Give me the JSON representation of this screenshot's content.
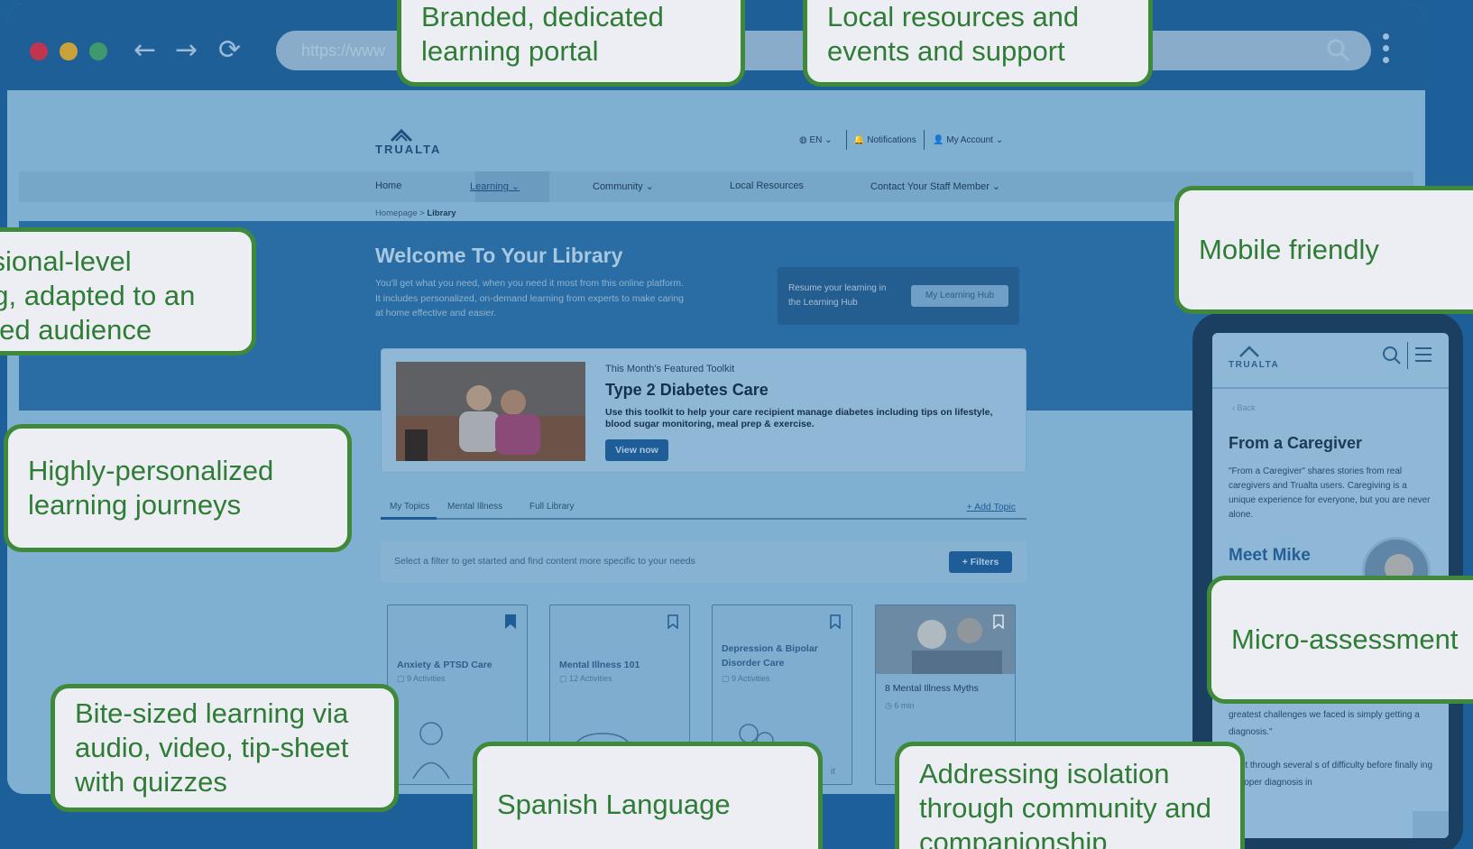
{
  "browser": {
    "url_placeholder": "https://www",
    "back_icon": "back-arrow-icon",
    "forward_icon": "forward-arrow-icon",
    "reload_icon": "reload-icon"
  },
  "site": {
    "logo_text": "TRUALTA",
    "lang": "EN",
    "notifications": "Notifications",
    "account": "My Account",
    "nav": {
      "home": "Home",
      "learning": "Learning",
      "community": "Community",
      "local": "Local Resources",
      "contact": "Contact Your Staff Member"
    },
    "breadcrumb": {
      "home": "Homepage",
      "sep": ">",
      "current": "Library"
    },
    "welcome_title": "Welcome To Your Library",
    "welcome_sub": "You'll get what you need, when you need it most from this online platform. It includes personalized, on-demand learning from experts to make caring at home effective and easier.",
    "resume_text": "Resume your learning in the Learning Hub",
    "resume_btn": "My Learning Hub",
    "featured": {
      "label": "This Month's Featured Toolkit",
      "title": "Type 2 Diabetes Care",
      "desc": "Use this toolkit to help your care recipient manage diabetes including tips on lifestyle, blood sugar monitoring, meal prep & exercise.",
      "btn": "View now"
    },
    "tabs": {
      "t1": "My Topics",
      "t2": "Mental Illness",
      "t3": "Full Library",
      "add": "+ Add Topic"
    },
    "filter_text": "Select a filter to get started and find content more specific to your needs",
    "filter_btn": "+ Filters",
    "cards": [
      {
        "title": "Anxiety & PTSD Care",
        "meta": "9 Activities"
      },
      {
        "title": "Mental Illness 101",
        "meta": "12 Activities"
      },
      {
        "title": "Depression & Bipolar Disorder Care",
        "meta": "9 Activities"
      },
      {
        "title": "8 Mental Illness Myths",
        "meta": "6 min"
      }
    ],
    "card3_partial": "it"
  },
  "phone": {
    "logo_text": "TRUALTA",
    "back": "‹ Back",
    "title": "From a Caregiver",
    "desc": "\"From a Caregiver\" shares stories from real caregivers and Trualta users. Caregiving is a unique experience for everyone, but you are never alone.",
    "meet": "Meet Mike",
    "quote": "greatest challenges we faced is simply getting a diagnosis.\"",
    "quote2": "went through several s of difficulty before finally ing a proper diagnosis in"
  },
  "callouts": {
    "branded": "Branded, dedicated learning portal",
    "local": "Local resources and events and support",
    "professional_l1": "ssional-level",
    "professional_l2": "ng, adapted to an",
    "professional_l3": "ined audience",
    "personalized": "Highly-personalized learning journeys",
    "mobile": "Mobile friendly",
    "micro": "Micro-assessment",
    "bite": "Bite-sized learning via audio, video, tip-sheet with quizzes",
    "spanish": "Spanish Language",
    "isolation": "Addressing isolation through community and companionship"
  },
  "colors": {
    "background": "#1d5f98",
    "callout_border": "#3f8a3a",
    "callout_text": "#2f7c37",
    "callout_fill": "#eceef3"
  }
}
